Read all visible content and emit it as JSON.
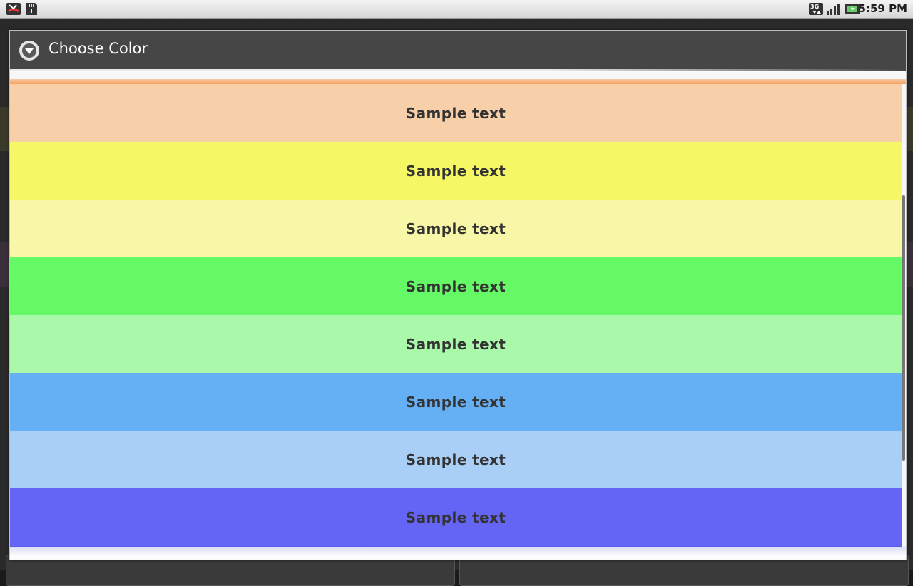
{
  "status_bar": {
    "time": "5:59 PM",
    "left_icons": [
      "missed-call-icon",
      "sd-card-icon"
    ],
    "right_icons": [
      "3g-icon",
      "signal-icon",
      "battery-icon"
    ]
  },
  "dialog": {
    "title": "Choose Color",
    "header_icon": "chevron-down-circle-icon"
  },
  "swatches": [
    {
      "label": "Sample text",
      "color": "#f7cfa8"
    },
    {
      "label": "Sample text",
      "color": "#f5f764"
    },
    {
      "label": "Sample text",
      "color": "#f8f7a8"
    },
    {
      "label": "Sample text",
      "color": "#66f966"
    },
    {
      "label": "Sample text",
      "color": "#aaf8aa"
    },
    {
      "label": "Sample text",
      "color": "#65aff5"
    },
    {
      "label": "Sample text",
      "color": "#aacff7"
    },
    {
      "label": "Sample text",
      "color": "#6464f5"
    }
  ],
  "colors": {
    "header_bg": "#464646",
    "accent_orange": "#f5a05a",
    "text": "#333333"
  }
}
